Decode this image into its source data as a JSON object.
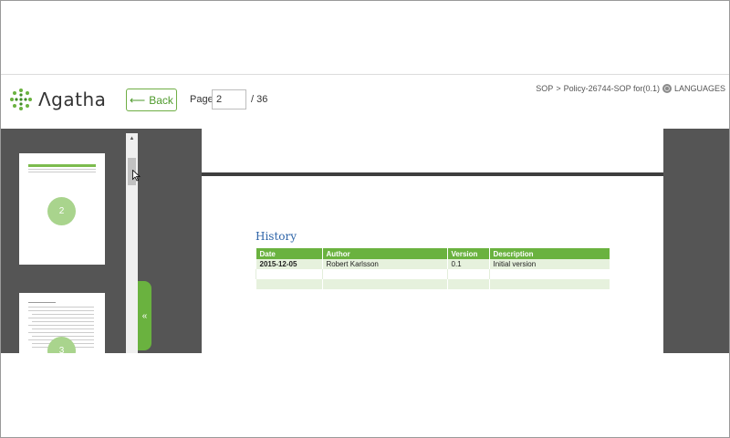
{
  "app": {
    "logo_text": "Λgatha"
  },
  "toolbar": {
    "back_label": "Back",
    "page_label": "Page",
    "page_value": "2",
    "page_total": "/ 36"
  },
  "breadcrumb": {
    "part1": "SOP",
    "separator": ">",
    "part2": "Policy-26744-SOP for(0.1)",
    "languages": "LANGUAGES"
  },
  "thumbnails": [
    {
      "page_number": "2"
    },
    {
      "page_number": "3"
    }
  ],
  "colors": {
    "accent": "#6ab23f",
    "history_title": "#2e64a8",
    "viewer_bg": "#555555"
  },
  "document": {
    "section_title": "History",
    "table": {
      "headers": [
        "Date",
        "Author",
        "Version",
        "Description"
      ],
      "rows": [
        [
          "2015-12-05",
          "Robert Karlsson",
          "0.1",
          "Initial version"
        ],
        [
          "",
          "",
          "",
          ""
        ],
        [
          "",
          "",
          "",
          ""
        ]
      ]
    }
  },
  "icons": {
    "collapse": "double-chevron-left-icon",
    "scroll_up": "triangle-up-icon"
  }
}
